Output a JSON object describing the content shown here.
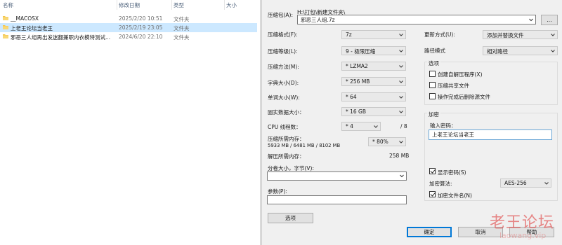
{
  "explorer": {
    "columns": {
      "name": "名称",
      "date": "修改日期",
      "type": "类型",
      "size": "大小"
    },
    "rows": [
      {
        "name": "__MACOSX",
        "date": "2025/2/20 10:51",
        "type": "文件夹",
        "selected": false
      },
      {
        "name": "上老王论坛当老王",
        "date": "2025/2/19 23:05",
        "type": "文件夹",
        "selected": true
      },
      {
        "name": "邪恶三人组再出发迷翻兼职内衣模特测试...",
        "date": "2024/6/20 22:10",
        "type": "文件夹",
        "selected": false
      }
    ]
  },
  "dialog": {
    "archive_label": "压缩包(A):",
    "archive_path": "H:\\打包\\新建文件夹\\",
    "archive_name": "邪恶三人组.7z",
    "browse_button": "...",
    "format": {
      "label": "压缩格式(F):",
      "value": "7z"
    },
    "level": {
      "label": "压缩等级(L):",
      "value": "9 - 极限压缩"
    },
    "method": {
      "label": "压缩方法(M):",
      "value": "* LZMA2"
    },
    "dict": {
      "label": "字典大小(D):",
      "value": "* 256 MB"
    },
    "word": {
      "label": "单词大小(W):",
      "value": "* 64"
    },
    "solid": {
      "label": "固实数据大小：",
      "value": "* 16 GB"
    },
    "threads": {
      "label": "CPU 线程数：",
      "value": "* 4",
      "max": "/ 8"
    },
    "mem_compress": {
      "label": "压缩所需内存：",
      "detail": "5933 MB / 6481 MB / 8102 MB",
      "value": "* 80%"
    },
    "mem_decompress": {
      "label": "解压所需内存：",
      "value": "258 MB"
    },
    "volume": {
      "label": "分卷大小，字节(V):",
      "value": ""
    },
    "params": {
      "label": "参数(P):",
      "value": ""
    },
    "options_button": "选项",
    "update_mode": {
      "label": "更新方式(U):",
      "value": "添加并替换文件"
    },
    "path_mode": {
      "label": "路径模式",
      "value": "相对路径"
    },
    "options_group": {
      "title": "选项",
      "sfx": {
        "label": "创建自解压程序(X)",
        "checked": false
      },
      "shared": {
        "label": "压缩共享文件",
        "checked": false
      },
      "delete_after": {
        "label": "操作完成后删除源文件",
        "checked": false
      }
    },
    "encryption": {
      "title": "加密",
      "password_label": "输入密码：",
      "password_value": "上老王论坛当老王",
      "show_password": {
        "label": "显示密码(S)",
        "checked": true
      },
      "method_label": "加密算法:",
      "method_value": "AES-256",
      "encrypt_names": {
        "label": "加密文件名(N)",
        "checked": true
      }
    },
    "ok_button": "确定",
    "cancel_button": "取消",
    "help_button": "帮助"
  },
  "watermark": {
    "text": "老王论坛",
    "subtext": "laowang.vip"
  },
  "colors": {
    "selection": "#cce8ff",
    "folder": "#f3c54a",
    "accent": "#0078d7",
    "watermark": "#e25c5c"
  }
}
